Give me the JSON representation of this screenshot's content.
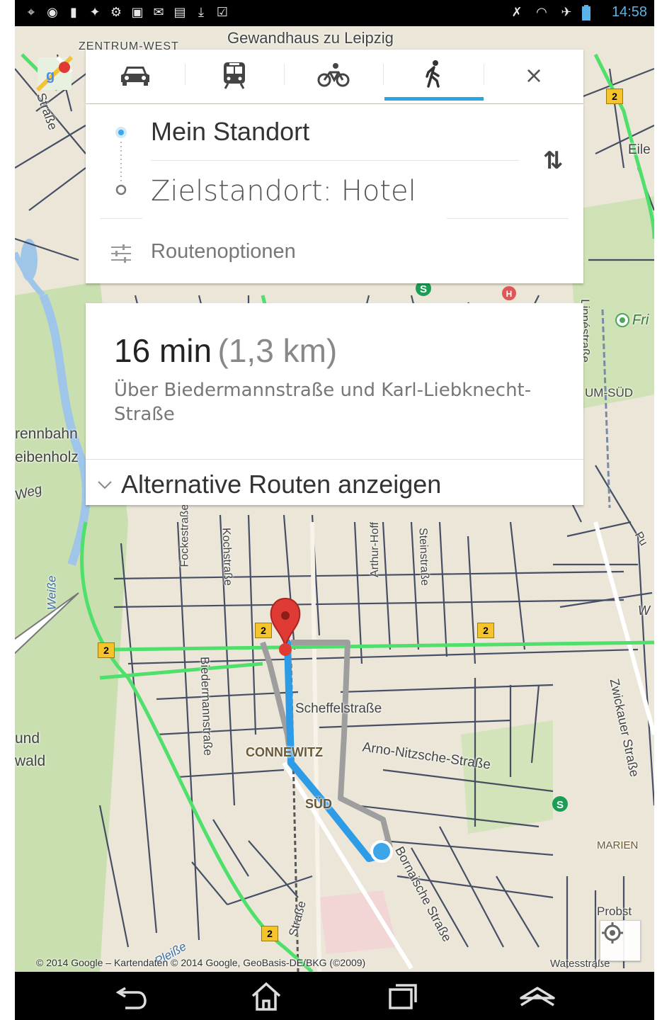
{
  "status_bar": {
    "time": "14:58",
    "left_icons": [
      "gps-icon",
      "headset-icon",
      "sd-card-icon",
      "android-icon",
      "settings-icon",
      "image-icon",
      "gmail-icon",
      "keyboard-icon",
      "download-icon",
      "clipboard-icon"
    ],
    "right_icons": [
      "mute-icon",
      "wifi-icon",
      "airplane-mode-icon",
      "battery-icon"
    ]
  },
  "transport_modes": {
    "tabs": [
      {
        "name": "car",
        "icon": "car-icon",
        "active": false
      },
      {
        "name": "transit",
        "icon": "train-icon",
        "active": false
      },
      {
        "name": "bicycle",
        "icon": "bicycle-icon",
        "active": false
      },
      {
        "name": "walking",
        "icon": "walking-icon",
        "active": true
      }
    ],
    "close_symbol": "×"
  },
  "directions": {
    "origin": "Mein Standort",
    "destination": "Zielstandort: Hotel",
    "swap_symbol": "⇅",
    "route_options": "Routenoptionen"
  },
  "route_summary": {
    "duration": "16 min",
    "distance": "(1,3 km)",
    "via": "Über Biedermannstraße und Karl-Liebknecht-Straße",
    "alternatives": "Alternative Routen anzeigen"
  },
  "map": {
    "labels": {
      "gewandhaus": "Gewandhaus zu Leipzig",
      "zentrum_west": "ZENTRUM-WEST",
      "strasse_tl": "Straße",
      "eile": "Eile",
      "fri": "Fri",
      "linnestrasse": "Linnéstraße",
      "um_sud": "UM-SÜD",
      "rennbahn": "rennbahn",
      "eibenholz": "eibenholz",
      "weg": "Weg",
      "weisse": "Weiße",
      "und": "und",
      "wald": "wald",
      "scheffelstrasse": "Scheffelstraße",
      "connewitz": "CONNEWITZ",
      "arno_nitzsche": "Arno-Nitzsche-Straße",
      "sud": "SÜD",
      "bornaische": "Bornaische Straße",
      "zwickauer": "Zwickauer Straße",
      "marien": "MARIEN",
      "probst": "Probst",
      "biedermannstrasse": "Biedermannstraße",
      "pleisse": "Pleiße",
      "strasse_bottom": "Straße",
      "arthur_hoff": "Arthur-Hoff",
      "kochstrasse": "Kochstraße",
      "fockestrasse": "Fockestraße",
      "kurt_eisner": "Steinstraße",
      "bornaische2": "Bornaische",
      "w": "W",
      "pu": "Pu",
      "wates": "Watesstraße"
    },
    "road_badges": [
      "2",
      "2",
      "2",
      "2",
      "2"
    ],
    "copyright": "© 2014 Google – Kartendaten © 2014 Google, GeoBasis-DE/BKG (©2009)",
    "colors": {
      "route_active": "#2d9be6",
      "route_alt": "#9e9e9e",
      "traffic": "#4fdf6b",
      "marker": "#e03a35",
      "location_dot": "#3da6e8"
    }
  },
  "nav_bar": {
    "buttons": [
      "back-icon",
      "home-icon",
      "recent-apps-icon",
      "menu-icon"
    ]
  }
}
